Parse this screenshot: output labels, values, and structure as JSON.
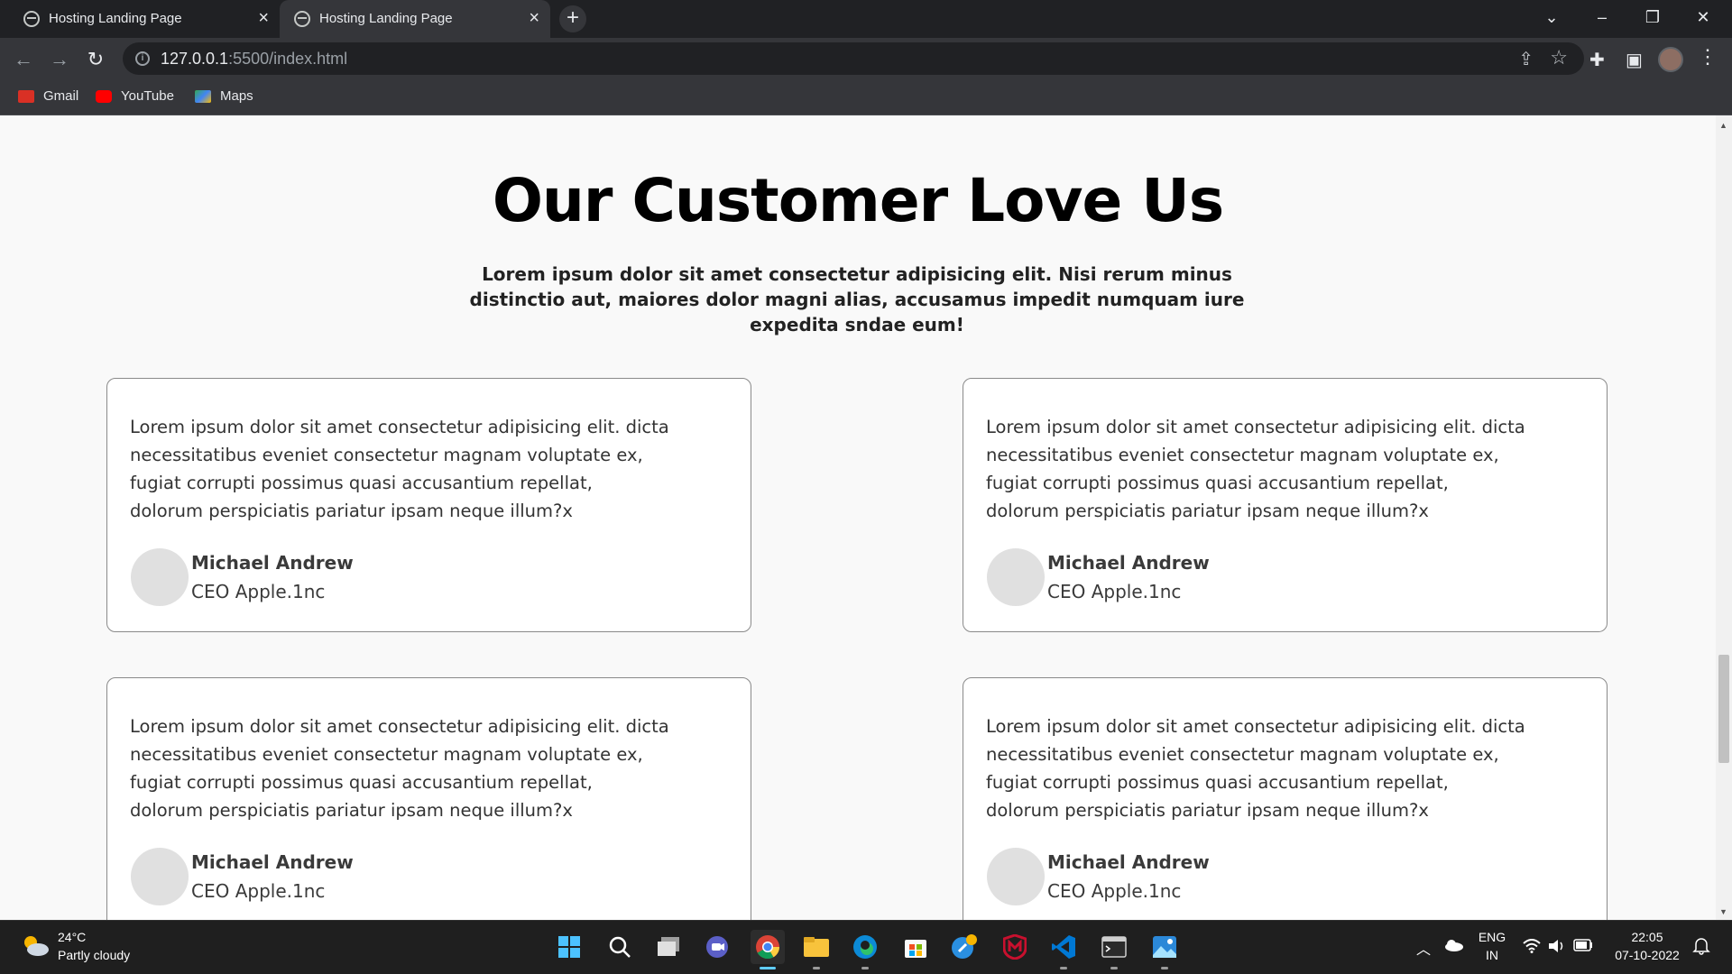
{
  "browser": {
    "tabs": [
      {
        "title": "Hosting Landing Page",
        "active": false
      },
      {
        "title": "Hosting Landing Page",
        "active": true
      }
    ],
    "url_host": "127.0.0.1",
    "url_rest": ":5500/index.html",
    "bookmarks": [
      {
        "label": "Gmail",
        "color": "#d93025"
      },
      {
        "label": "YouTube",
        "color": "#ff0000"
      },
      {
        "label": "Maps",
        "color": "#34a853"
      }
    ]
  },
  "page": {
    "heading": "Our Customer Love Us",
    "subtitle": "Lorem ipsum dolor sit amet consectetur adipisicing elit. Nisi rerum minus distinctio aut, maiores dolor magni alias, accusamus impedit numquam iure expedita sndae eum!",
    "testimonials": [
      {
        "quote": "Lorem ipsum dolor sit amet consectetur adipisicing elit. dicta necessitatibus eveniet consectetur magnam voluptate ex, fugiat corrupti possimus quasi accusantium repellat, dolorum perspiciatis pariatur ipsam neque illum?x",
        "name": "Michael Andrew",
        "role": "CEO Apple.1nc"
      },
      {
        "quote": "Lorem ipsum dolor sit amet consectetur adipisicing elit. dicta necessitatibus eveniet consectetur magnam voluptate ex, fugiat corrupti possimus quasi accusantium repellat, dolorum perspiciatis pariatur ipsam neque illum?x",
        "name": "Michael Andrew",
        "role": "CEO Apple.1nc"
      },
      {
        "quote": "Lorem ipsum dolor sit amet consectetur adipisicing elit. dicta necessitatibus eveniet consectetur magnam voluptate ex, fugiat corrupti possimus quasi accusantium repellat, dolorum perspiciatis pariatur ipsam neque illum?x",
        "name": "Michael Andrew",
        "role": "CEO Apple.1nc"
      },
      {
        "quote": "Lorem ipsum dolor sit amet consectetur adipisicing elit. dicta necessitatibus eveniet consectetur magnam voluptate ex, fugiat corrupti possimus quasi accusantium repellat, dolorum perspiciatis pariatur ipsam neque illum?x",
        "name": "Michael Andrew",
        "role": "CEO Apple.1nc"
      }
    ]
  },
  "taskbar": {
    "weather_temp": "24°C",
    "weather_desc": "Partly cloudy",
    "lang_top": "ENG",
    "lang_bottom": "IN",
    "time": "22:05",
    "date": "07-10-2022",
    "apps": [
      "start-icon",
      "search-icon",
      "task-view-icon",
      "chat-icon",
      "chrome-icon",
      "file-explorer-icon",
      "edge-icon",
      "store-icon",
      "settings-icon",
      "mcafee-icon",
      "vscode-icon",
      "terminal-icon",
      "photos-icon"
    ]
  }
}
